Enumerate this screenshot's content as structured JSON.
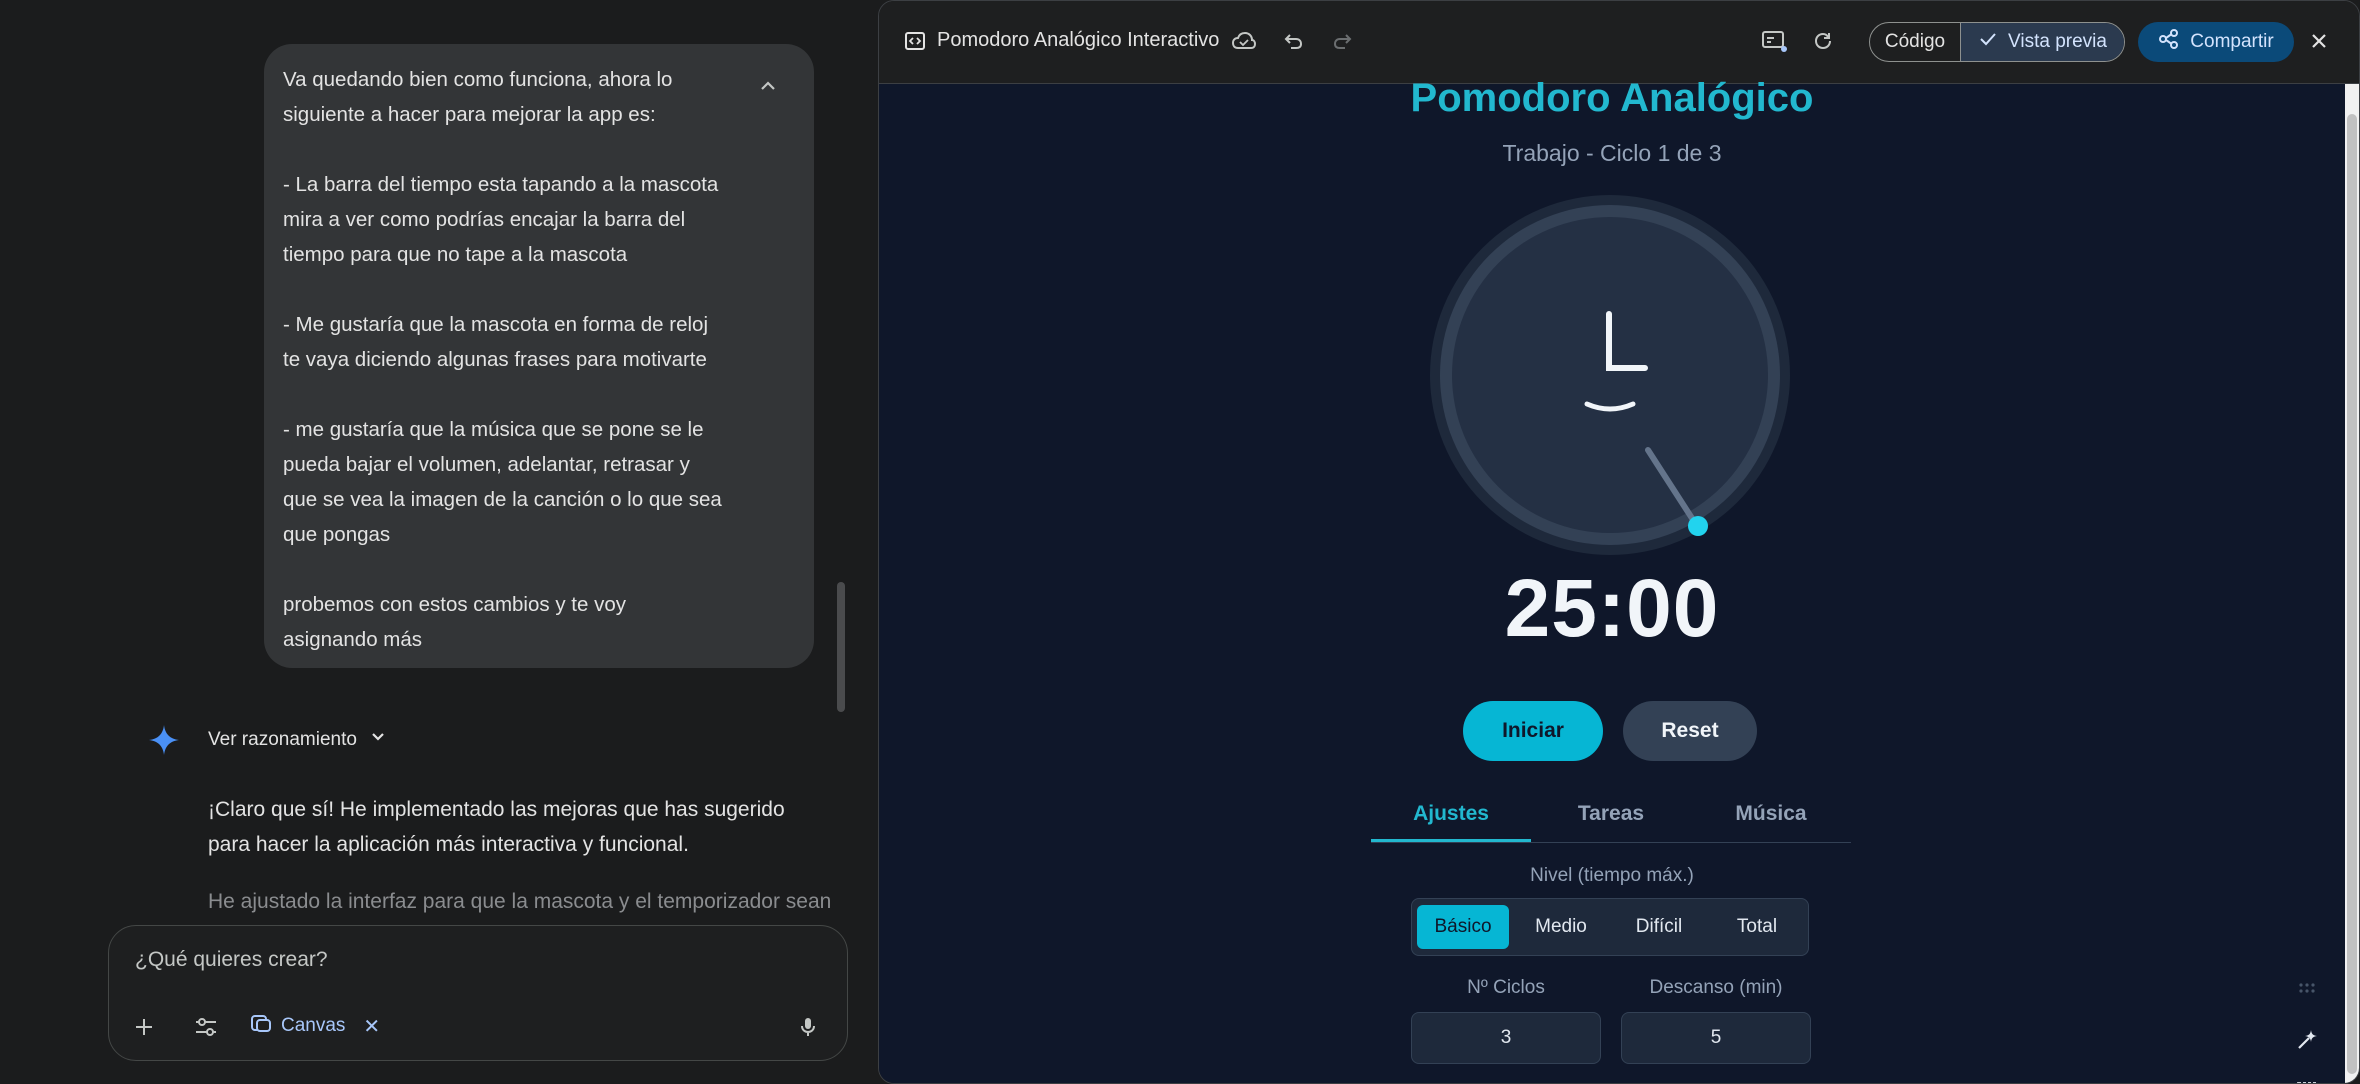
{
  "chat": {
    "user_message": [
      "Va quedando bien como funciona, ahora lo siguiente a hacer para mejorar la app es:",
      "- La barra del tiempo esta tapando a la mascota mira a ver como podrías encajar la barra del tiempo para que no tape a la mascota",
      "- Me gustaría que la mascota en forma de reloj te vaya diciendo algunas frases para motivarte",
      "- me gustaría que la música que se pone se le pueda bajar el volumen, adelantar, retrasar y que se vea la imagen de la canción o lo que sea que pongas",
      "probemos con estos cambios y te voy asignando más"
    ],
    "reasoning_label": "Ver razonamiento",
    "reply_1": "¡Claro que sí! He implementado las mejoras que has sugerido para hacer la aplicación más interactiva y funcional.",
    "reply_2": "He ajustado la interfaz para que la mascota y el temporizador sean",
    "input_placeholder": "¿Qué quieres crear?",
    "canvas_chip": "Canvas"
  },
  "canvas_toolbar": {
    "title": "Pomodoro Analógico Interactivo",
    "code_label": "Código",
    "preview_label": "Vista previa",
    "share_label": "Compartir"
  },
  "app": {
    "title": "Pomodoro Analógico",
    "subtitle": "Trabajo - Ciclo 1 de 3",
    "timer": "25:00",
    "start_label": "Iniciar",
    "reset_label": "Reset",
    "tabs": [
      "Ajustes",
      "Tareas",
      "Música"
    ],
    "active_tab": "Ajustes",
    "level_label": "Nivel (tiempo máx.)",
    "levels": [
      "Básico",
      "Medio",
      "Difícil",
      "Total"
    ],
    "active_level": "Básico",
    "cycles_label": "Nº Ciclos",
    "cycles_value": "3",
    "break_label": "Descanso (min)",
    "break_value": "5"
  },
  "colors": {
    "accent": "#06b6d4",
    "app_background": "#0f172a",
    "share_button": "#0b4a79",
    "chat_bubble": "#333537"
  },
  "icons": {
    "toolbar": [
      "code-icon",
      "cloud-save-icon",
      "undo-icon",
      "redo-icon",
      "console-icon",
      "refresh-icon",
      "check-icon",
      "share-icon",
      "close-icon"
    ],
    "chat": [
      "collapse-icon",
      "gemini-star-icon",
      "chevron-down-icon",
      "plus-icon",
      "tools-icon",
      "canvas-icon",
      "mic-icon"
    ]
  }
}
